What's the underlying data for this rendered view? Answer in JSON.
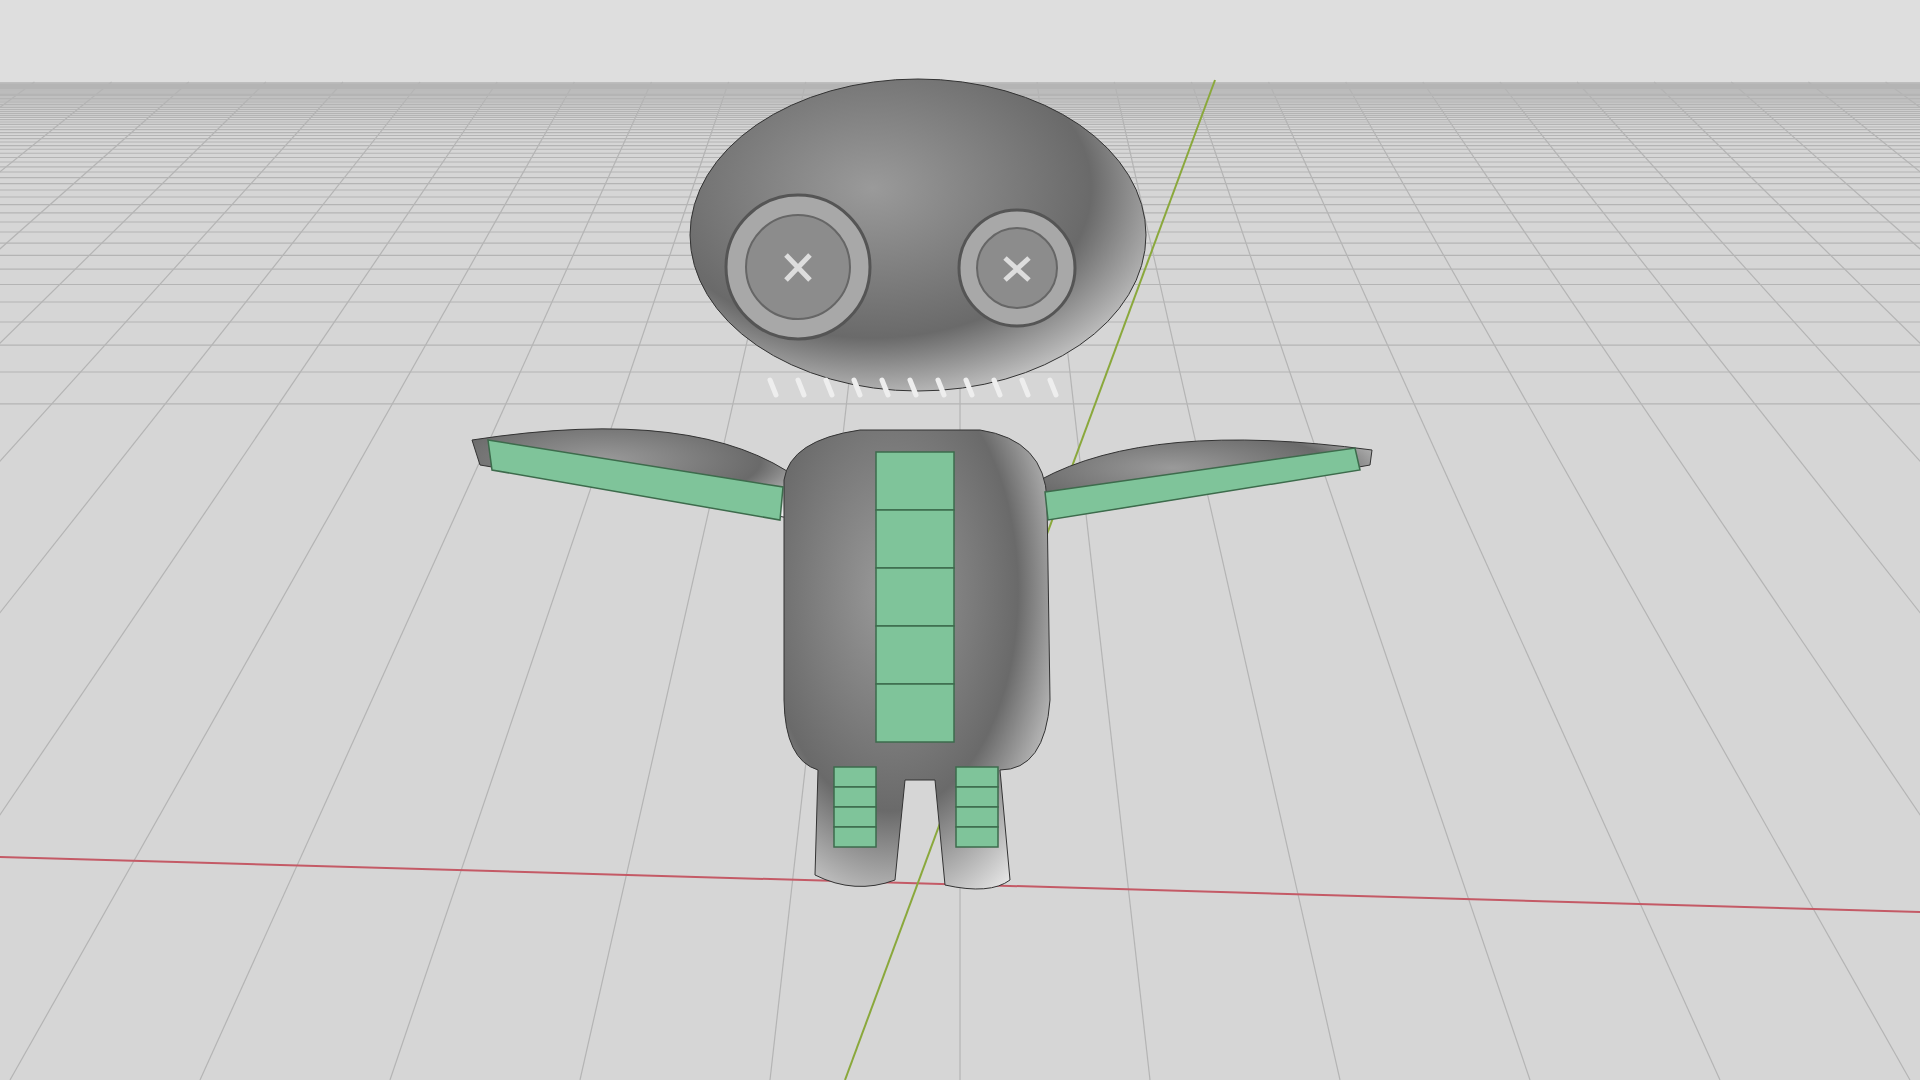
{
  "viewport": {
    "show_floor_grid": true,
    "show_axes": true
  }
}
